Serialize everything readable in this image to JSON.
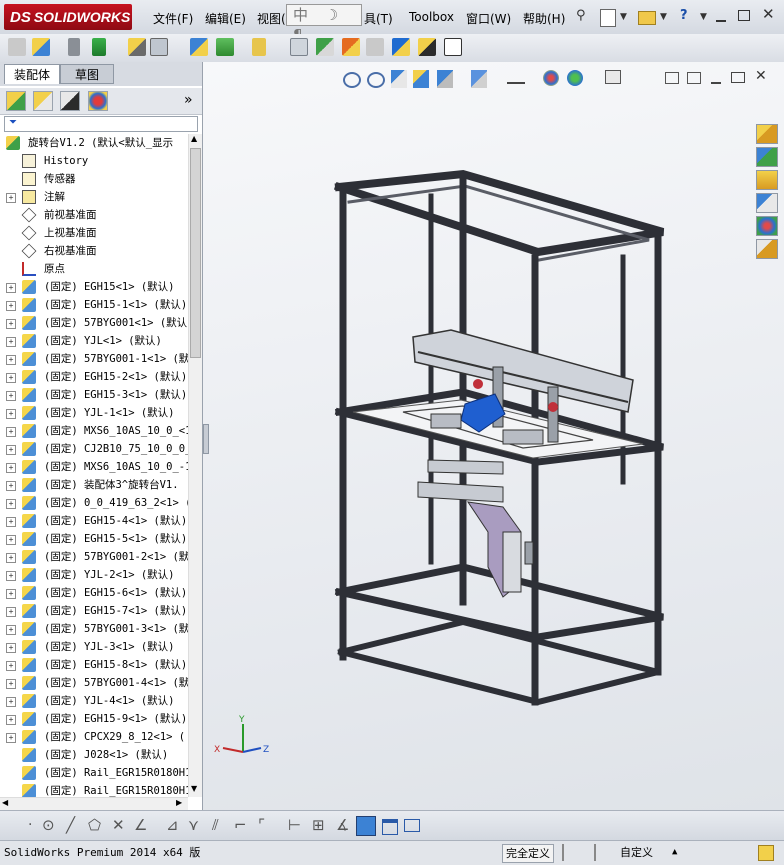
{
  "app": {
    "logo": "SOLIDWORKS",
    "logo_mark": "DS",
    "menu": [
      "文件(F)",
      "编辑(E)",
      "视图(",
      "具(T)",
      "Toolbox",
      "窗口(W)",
      "帮助(H)"
    ],
    "ime_chars": "中 ☽ ¶"
  },
  "manager": {
    "tabs": [
      "装配体",
      "草图"
    ],
    "active_tab": "装配体",
    "filter_icon": "funnel-icon",
    "expand_more": "»"
  },
  "tree": [
    {
      "label": "旋转台V1.2  (默认<默认_显示",
      "icon": "assembly-icon",
      "expander": false,
      "indent": 0
    },
    {
      "label": "History",
      "icon": "history-icon",
      "expander": false,
      "indent": 1
    },
    {
      "label": "传感器",
      "icon": "sensor-icon",
      "expander": false,
      "indent": 1
    },
    {
      "label": "注解",
      "icon": "annotation-icon",
      "expander": true,
      "indent": 1
    },
    {
      "label": "前视基准面",
      "icon": "plane-icon",
      "expander": false,
      "indent": 1
    },
    {
      "label": "上视基准面",
      "icon": "plane-icon",
      "expander": false,
      "indent": 1
    },
    {
      "label": "右视基准面",
      "icon": "plane-icon",
      "expander": false,
      "indent": 1
    },
    {
      "label": "原点",
      "icon": "origin-icon",
      "expander": false,
      "indent": 1
    },
    {
      "label": "(固定) EGH15<1> (默认)",
      "icon": "part-icon",
      "expander": true,
      "indent": 1
    },
    {
      "label": "(固定) EGH15-1<1> (默认)",
      "icon": "part-icon",
      "expander": true,
      "indent": 1
    },
    {
      "label": "(固定) 57BYG001<1> (默认",
      "icon": "part-icon",
      "expander": true,
      "indent": 1
    },
    {
      "label": "(固定) YJL<1> (默认)",
      "icon": "part-icon",
      "expander": true,
      "indent": 1
    },
    {
      "label": "(固定) 57BYG001-1<1> (默",
      "icon": "part-icon",
      "expander": true,
      "indent": 1
    },
    {
      "label": "(固定) EGH15-2<1> (默认)",
      "icon": "part-icon",
      "expander": true,
      "indent": 1
    },
    {
      "label": "(固定) EGH15-3<1> (默认)",
      "icon": "part-icon",
      "expander": true,
      "indent": 1
    },
    {
      "label": "(固定) YJL-1<1> (默认)",
      "icon": "part-icon",
      "expander": true,
      "indent": 1
    },
    {
      "label": "(固定) MXS6_10AS_10_0_<1",
      "icon": "part-icon",
      "expander": true,
      "indent": 1
    },
    {
      "label": "(固定) CJ2B10_75_10_0_0_",
      "icon": "part-icon",
      "expander": true,
      "indent": 1
    },
    {
      "label": "(固定) MXS6_10AS_10_0_-1",
      "icon": "part-icon",
      "expander": true,
      "indent": 1
    },
    {
      "label": "(固定) 装配体3^旋转台V1.",
      "icon": "part-icon",
      "expander": true,
      "indent": 1
    },
    {
      "label": "(固定) 0_0_419_63_2<1> (",
      "icon": "part-icon",
      "expander": true,
      "indent": 1
    },
    {
      "label": "(固定) EGH15-4<1> (默认)",
      "icon": "part-icon",
      "expander": true,
      "indent": 1
    },
    {
      "label": "(固定) EGH15-5<1> (默认)",
      "icon": "part-icon",
      "expander": true,
      "indent": 1
    },
    {
      "label": "(固定) 57BYG001-2<1> (默",
      "icon": "part-icon",
      "expander": true,
      "indent": 1
    },
    {
      "label": "(固定) YJL-2<1> (默认)",
      "icon": "part-icon",
      "expander": true,
      "indent": 1
    },
    {
      "label": "(固定) EGH15-6<1> (默认)",
      "icon": "part-icon",
      "expander": true,
      "indent": 1
    },
    {
      "label": "(固定) EGH15-7<1> (默认)",
      "icon": "part-icon",
      "expander": true,
      "indent": 1
    },
    {
      "label": "(固定) 57BYG001-3<1> (默",
      "icon": "part-icon",
      "expander": true,
      "indent": 1
    },
    {
      "label": "(固定) YJL-3<1> (默认)",
      "icon": "part-icon",
      "expander": true,
      "indent": 1
    },
    {
      "label": "(固定) EGH15-8<1> (默认)",
      "icon": "part-icon",
      "expander": true,
      "indent": 1
    },
    {
      "label": "(固定) 57BYG001-4<1> (默",
      "icon": "part-icon",
      "expander": true,
      "indent": 1
    },
    {
      "label": "(固定) YJL-4<1> (默认)",
      "icon": "part-icon",
      "expander": true,
      "indent": 1
    },
    {
      "label": "(固定) EGH15-9<1> (默认)",
      "icon": "part-icon",
      "expander": true,
      "indent": 1
    },
    {
      "label": "(固定) CPCX29_8_12<1> (",
      "icon": "part-icon",
      "expander": true,
      "indent": 1
    },
    {
      "label": "(固定) J028<1> (默认)",
      "icon": "part-icon",
      "expander": false,
      "indent": 1
    },
    {
      "label": "(固定) Rail_EGR15R0180H1",
      "icon": "part-icon",
      "expander": false,
      "indent": 1
    },
    {
      "label": "(固定) Rail_EGR15R0180H1",
      "icon": "part-icon",
      "expander": false,
      "indent": 1
    }
  ],
  "triad": {
    "x": "X",
    "y": "Y",
    "z": "Z"
  },
  "status": {
    "product": "SolidWorks Premium 2014 x64 版",
    "definition": "完全定义",
    "mode": "自定义",
    "arrow": "▲"
  },
  "colors": {
    "frame": "#2d2f36",
    "accent_blue": "#1f5fd0",
    "logo_red": "#b3101c",
    "mount_purple": "#a99cc0"
  }
}
